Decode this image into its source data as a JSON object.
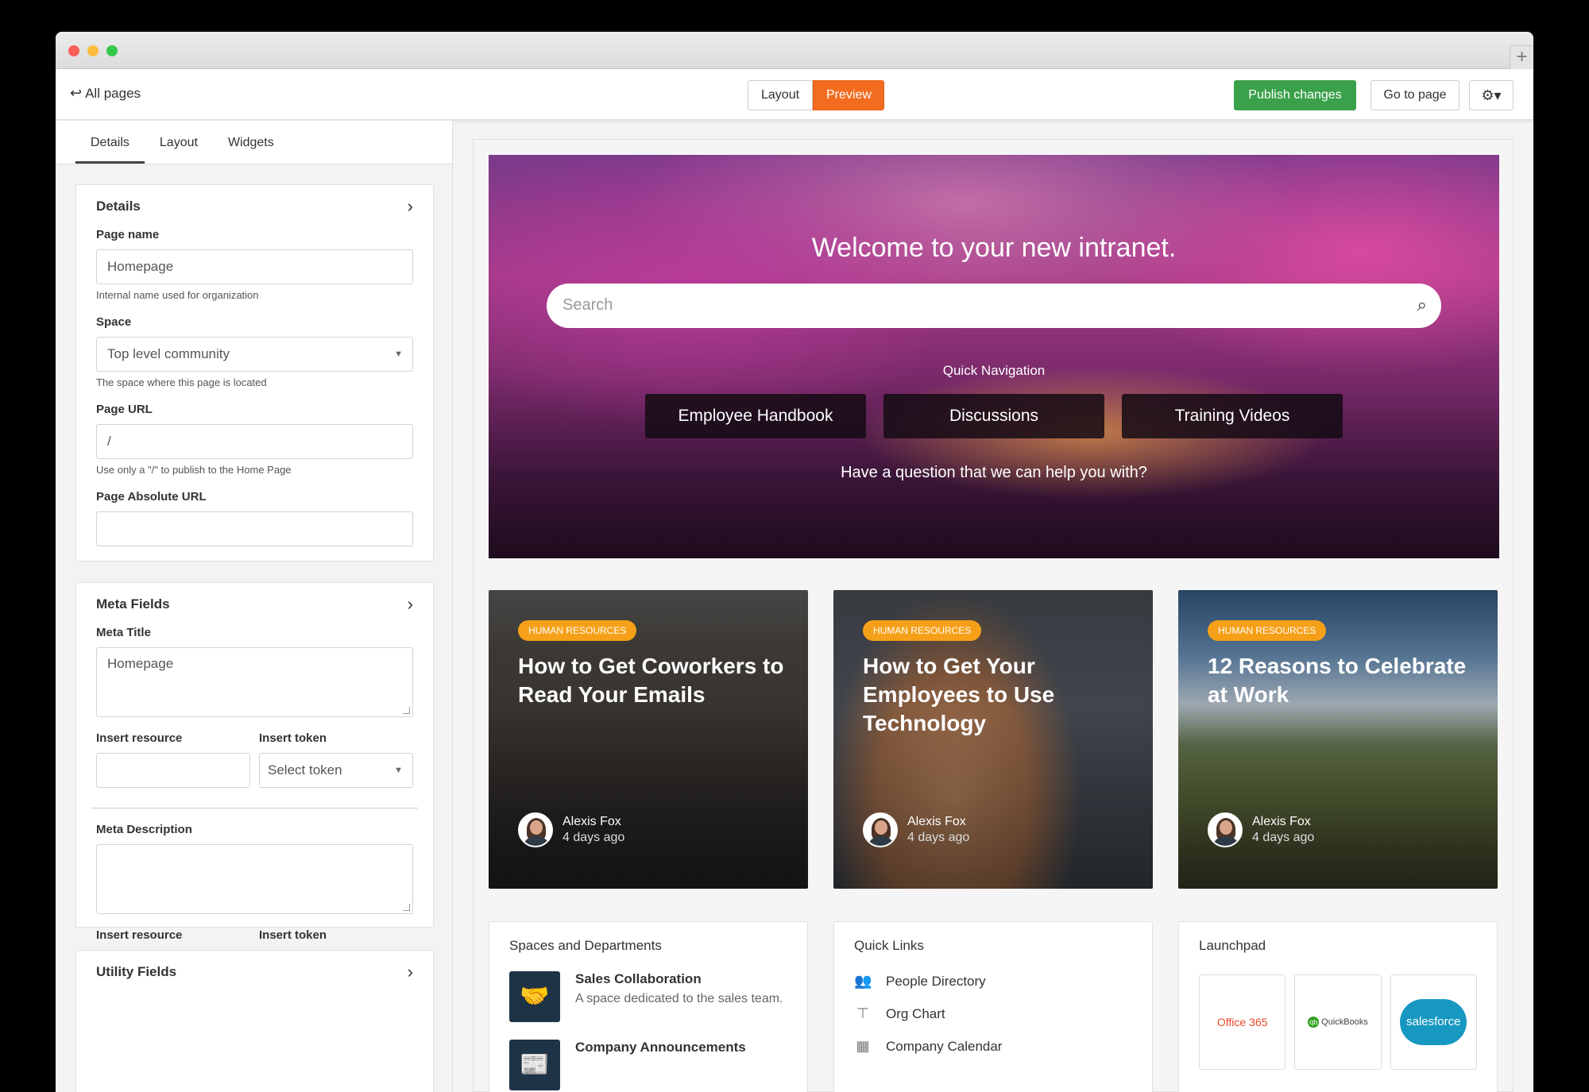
{
  "toolbar": {
    "all_pages": "All pages",
    "layout": "Layout",
    "preview": "Preview",
    "publish": "Publish changes",
    "go_to_page": "Go to page"
  },
  "sidebar": {
    "tabs": [
      "Details",
      "Layout",
      "Widgets"
    ],
    "details": {
      "title": "Details",
      "page_name_label": "Page name",
      "page_name_value": "Homepage",
      "page_name_help": "Internal name used for organization",
      "space_label": "Space",
      "space_value": "Top level community",
      "space_help": "The space where this page is located",
      "page_url_label": "Page URL",
      "page_url_value": "/",
      "page_url_help": "Use only a \"/\" to publish to the Home Page",
      "absolute_url_label": "Page Absolute URL",
      "absolute_url_value": ""
    },
    "meta": {
      "title": "Meta Fields",
      "meta_title_label": "Meta Title",
      "meta_title_value": "Homepage",
      "insert_resource": "Insert resource",
      "insert_token": "Insert token",
      "select_token": "Select token",
      "meta_desc_label": "Meta Description"
    },
    "utility": {
      "title": "Utility Fields"
    }
  },
  "hero": {
    "title": "Welcome to your new intranet.",
    "search_placeholder": "Search",
    "quick_nav": "Quick Navigation",
    "nav_buttons": [
      "Employee Handbook",
      "Discussions",
      "Training Videos"
    ],
    "question": "Have a question that we can help you with?"
  },
  "cards": [
    {
      "badge": "HUMAN RESOURCES",
      "title": "How to Get Coworkers to Read Your Emails",
      "author": "Alexis Fox",
      "time": "4 days ago"
    },
    {
      "badge": "HUMAN RESOURCES",
      "title": "How to Get Your Employees to Use Technology",
      "author": "Alexis Fox",
      "time": "4 days ago"
    },
    {
      "badge": "HUMAN RESOURCES",
      "title": "12 Reasons to Celebrate at Work",
      "author": "Alexis Fox",
      "time": "4 days ago"
    }
  ],
  "spaces": {
    "title": "Spaces and Departments",
    "items": [
      {
        "name": "Sales Collaboration",
        "desc": "A space dedicated to the sales team.",
        "icon": "handshake-icon"
      },
      {
        "name": "Company Announcements",
        "desc": "",
        "icon": "newspaper-icon"
      }
    ]
  },
  "quick_links": {
    "title": "Quick Links",
    "items": [
      {
        "label": "People Directory",
        "icon": "people-icon"
      },
      {
        "label": "Org Chart",
        "icon": "org-chart-icon"
      },
      {
        "label": "Company Calendar",
        "icon": "calendar-icon"
      }
    ]
  },
  "launchpad": {
    "title": "Launchpad",
    "apps": [
      "Office 365",
      "QuickBooks",
      "salesforce"
    ]
  },
  "colors": {
    "preview_orange": "#f26c1f",
    "publish_green": "#3aa14a",
    "badge_orange": "#f5a018"
  }
}
